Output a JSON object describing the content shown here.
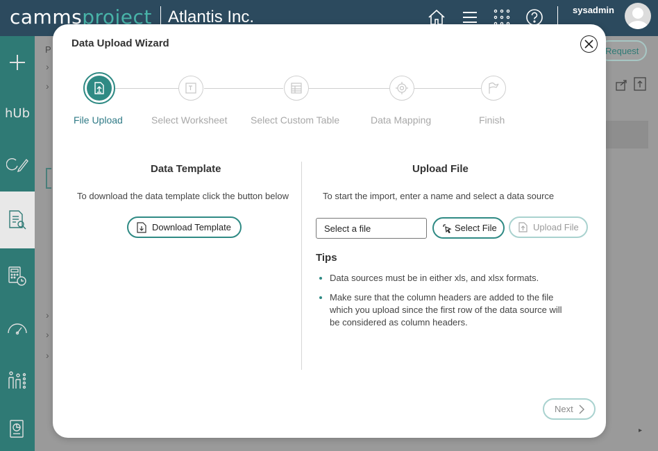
{
  "header": {
    "logo_main": "camms",
    "logo_accent": "project",
    "company": "Atlantis Inc.",
    "username": "sysadmin",
    "icons": [
      "home-icon",
      "menu-icon",
      "apps-grid-icon",
      "help-icon"
    ]
  },
  "sidebar": {
    "items": [
      {
        "icon": "plus-icon"
      },
      {
        "label": "hUb",
        "icon": "hub-icon"
      },
      {
        "icon": "refresh-edit-icon"
      },
      {
        "icon": "document-search-icon"
      },
      {
        "icon": "calculator-clock-icon"
      },
      {
        "icon": "gauge-icon"
      },
      {
        "icon": "people-chart-icon"
      },
      {
        "icon": "report-icon"
      }
    ]
  },
  "background": {
    "request_label": "Request",
    "letter": "P"
  },
  "modal": {
    "title": "Data Upload Wizard",
    "steps": [
      {
        "label": "File Upload",
        "icon": "upload-icon",
        "active": true
      },
      {
        "label": "Select Worksheet",
        "icon": "worksheet-icon",
        "active": false
      },
      {
        "label": "Select Custom Table",
        "icon": "table-icon",
        "active": false
      },
      {
        "label": "Data Mapping",
        "icon": "target-icon",
        "active": false
      },
      {
        "label": "Finish",
        "icon": "flag-icon",
        "active": false
      }
    ],
    "template": {
      "title": "Data Template",
      "description": "To download the data template click the button below",
      "download_button": "Download Template"
    },
    "upload": {
      "title": "Upload File",
      "description": "To start the import, enter a name and select a data source",
      "file_input_value": "Select a file",
      "select_button": "Select File",
      "upload_button": "Upload File"
    },
    "tips": {
      "title": "Tips",
      "items": [
        "Data sources must be in either xls, and xlsx formats.",
        "Make sure that the column headers are added to the file which you upload since the first row of the data source will be considered as column headers."
      ]
    },
    "next_button": "Next"
  },
  "colors": {
    "header_bg": "#2c4a5e",
    "accent": "#2f8a84",
    "sidebar_bg": "#2f7a75"
  }
}
